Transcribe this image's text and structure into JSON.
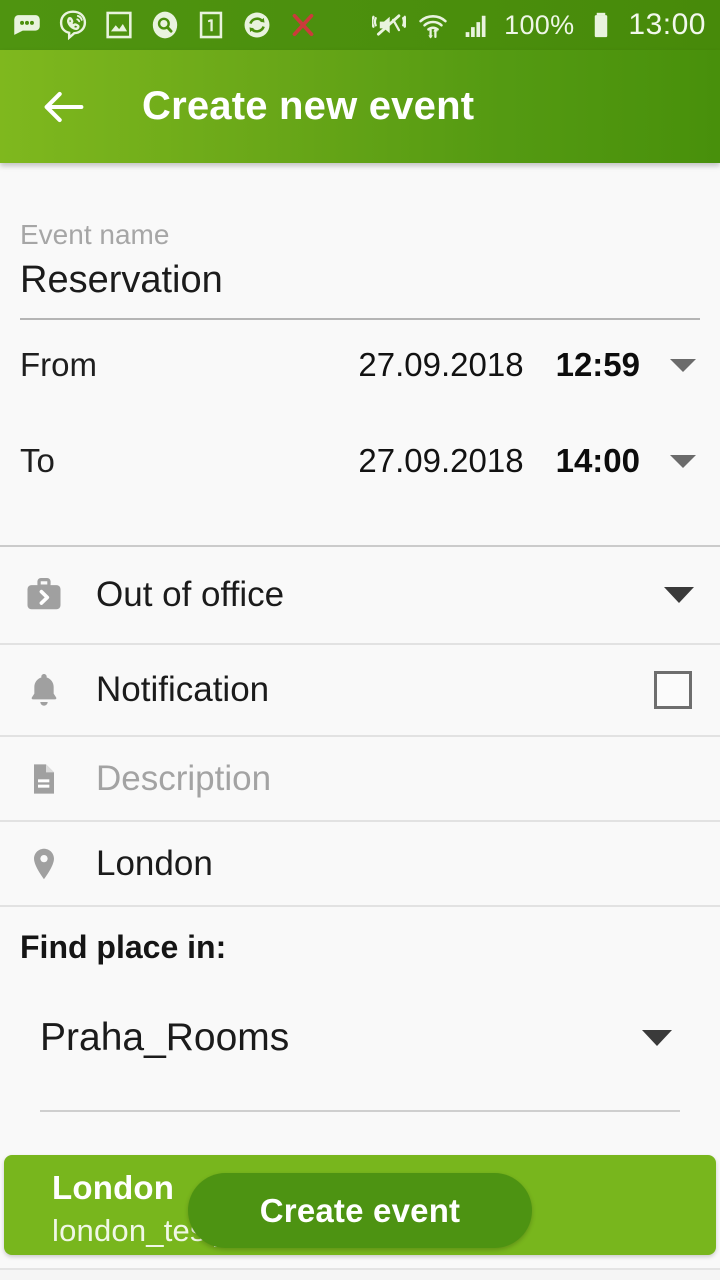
{
  "status_bar": {
    "icons_left": [
      "messages-icon",
      "viber-icon",
      "gallery-icon",
      "search-icon",
      "one-note-icon",
      "sync-icon",
      "missed-call-icon"
    ],
    "icons_right": [
      "mute-vibrate-icon",
      "wifi-icon",
      "signal-icon",
      "battery-icon"
    ],
    "battery_percent": "100%",
    "clock": "13:00"
  },
  "app_bar": {
    "back_icon": "back-arrow-icon",
    "title": "Create new event",
    "gradient_from": "#7fb81e",
    "gradient_to": "#48900b"
  },
  "form": {
    "event_name": {
      "label": "Event name",
      "value": "Reservation"
    },
    "from": {
      "label": "From",
      "date": "27.09.2018",
      "time": "12:59",
      "caret_icon": "chevron-down-icon"
    },
    "to": {
      "label": "To",
      "date": "27.09.2018",
      "time": "14:00",
      "caret_icon": "chevron-down-icon"
    },
    "availability": {
      "icon": "briefcase-icon",
      "value": "Out of office",
      "caret_icon": "chevron-down-icon"
    },
    "notification": {
      "icon": "bell-icon",
      "label": "Notification",
      "checked": false
    },
    "description": {
      "icon": "document-icon",
      "placeholder": "Description",
      "value": ""
    },
    "location": {
      "icon": "map-pin-icon",
      "value": "London"
    },
    "find_place": {
      "label": "Find place in:",
      "selected": "Praha_Rooms",
      "caret_icon": "chevron-down-icon"
    }
  },
  "bottom": {
    "card": {
      "title": "London",
      "subtitle": "london_test_",
      "color": "#78b61d"
    },
    "create_button": {
      "label": "Create event",
      "color": "#4d9312"
    }
  }
}
